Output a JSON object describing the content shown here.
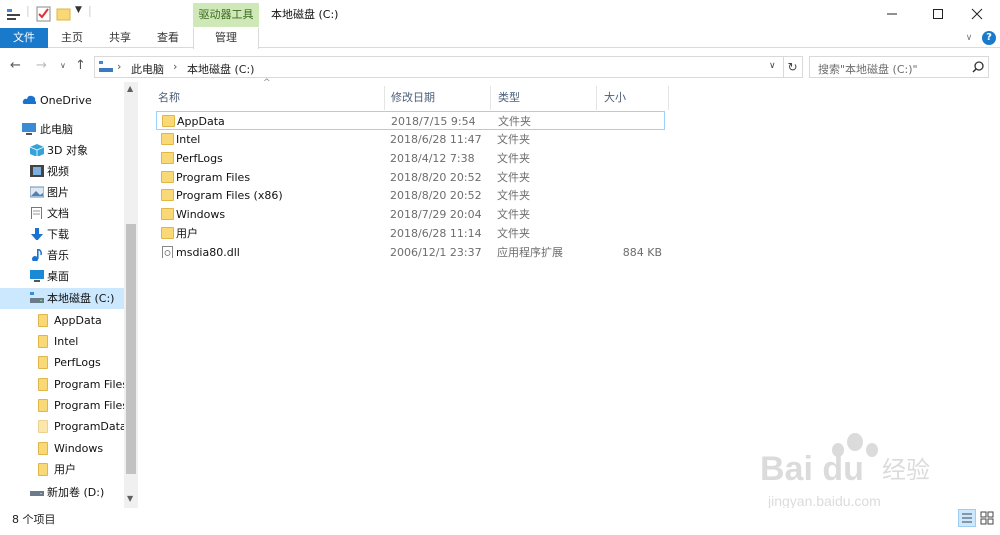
{
  "window": {
    "title": "本地磁盘 (C:)",
    "context_tab": "驱动器工具"
  },
  "ribbon": {
    "tabs": [
      "文件",
      "主页",
      "共享",
      "查看",
      "管理"
    ]
  },
  "address": {
    "crumbs": [
      "此电脑",
      "本地磁盘 (C:)"
    ],
    "search_placeholder": "搜索\"本地磁盘 (C:)\""
  },
  "nav": {
    "items": [
      {
        "label": "OneDrive",
        "icon": "cloud-icon"
      },
      {
        "label": "此电脑",
        "icon": "computer-icon"
      },
      {
        "label": "3D 对象",
        "icon": "cube-icon"
      },
      {
        "label": "视频",
        "icon": "video-icon"
      },
      {
        "label": "图片",
        "icon": "picture-icon"
      },
      {
        "label": "文档",
        "icon": "document-icon"
      },
      {
        "label": "下载",
        "icon": "download-icon"
      },
      {
        "label": "音乐",
        "icon": "music-icon"
      },
      {
        "label": "桌面",
        "icon": "desktop-icon"
      },
      {
        "label": "本地磁盘 (C:)",
        "icon": "drive-icon"
      },
      {
        "label": "AppData",
        "icon": "folder-icon"
      },
      {
        "label": "Intel",
        "icon": "folder-icon"
      },
      {
        "label": "PerfLogs",
        "icon": "folder-icon"
      },
      {
        "label": "Program Files",
        "icon": "folder-icon"
      },
      {
        "label": "Program Files",
        "icon": "folder-icon"
      },
      {
        "label": "ProgramData",
        "icon": "folder-icon"
      },
      {
        "label": "Windows",
        "icon": "folder-icon"
      },
      {
        "label": "用户",
        "icon": "folder-icon"
      },
      {
        "label": "新加卷 (D:)",
        "icon": "drive-icon"
      }
    ]
  },
  "columns": {
    "name": "名称",
    "date": "修改日期",
    "type": "类型",
    "size": "大小"
  },
  "files": [
    {
      "name": "AppData",
      "date": "2018/7/15 9:54",
      "type": "文件夹",
      "size": ""
    },
    {
      "name": "Intel",
      "date": "2018/6/28 11:47",
      "type": "文件夹",
      "size": ""
    },
    {
      "name": "PerfLogs",
      "date": "2018/4/12 7:38",
      "type": "文件夹",
      "size": ""
    },
    {
      "name": "Program Files",
      "date": "2018/8/20 20:52",
      "type": "文件夹",
      "size": ""
    },
    {
      "name": "Program Files (x86)",
      "date": "2018/8/20 20:52",
      "type": "文件夹",
      "size": ""
    },
    {
      "name": "Windows",
      "date": "2018/7/29 20:04",
      "type": "文件夹",
      "size": ""
    },
    {
      "name": "用户",
      "date": "2018/6/28 11:14",
      "type": "文件夹",
      "size": ""
    },
    {
      "name": "msdia80.dll",
      "date": "2006/12/1 23:37",
      "type": "应用程序扩展",
      "size": "884 KB"
    }
  ],
  "status": {
    "count": "8 个项目"
  },
  "watermark": {
    "brand": "Baidu 经验",
    "url": "jingyan.baidu.com"
  },
  "colors": {
    "accent": "#1979ca",
    "context_tab": "#cfe8b8",
    "selection": "#cce8ff",
    "folder": "#f9d876"
  }
}
